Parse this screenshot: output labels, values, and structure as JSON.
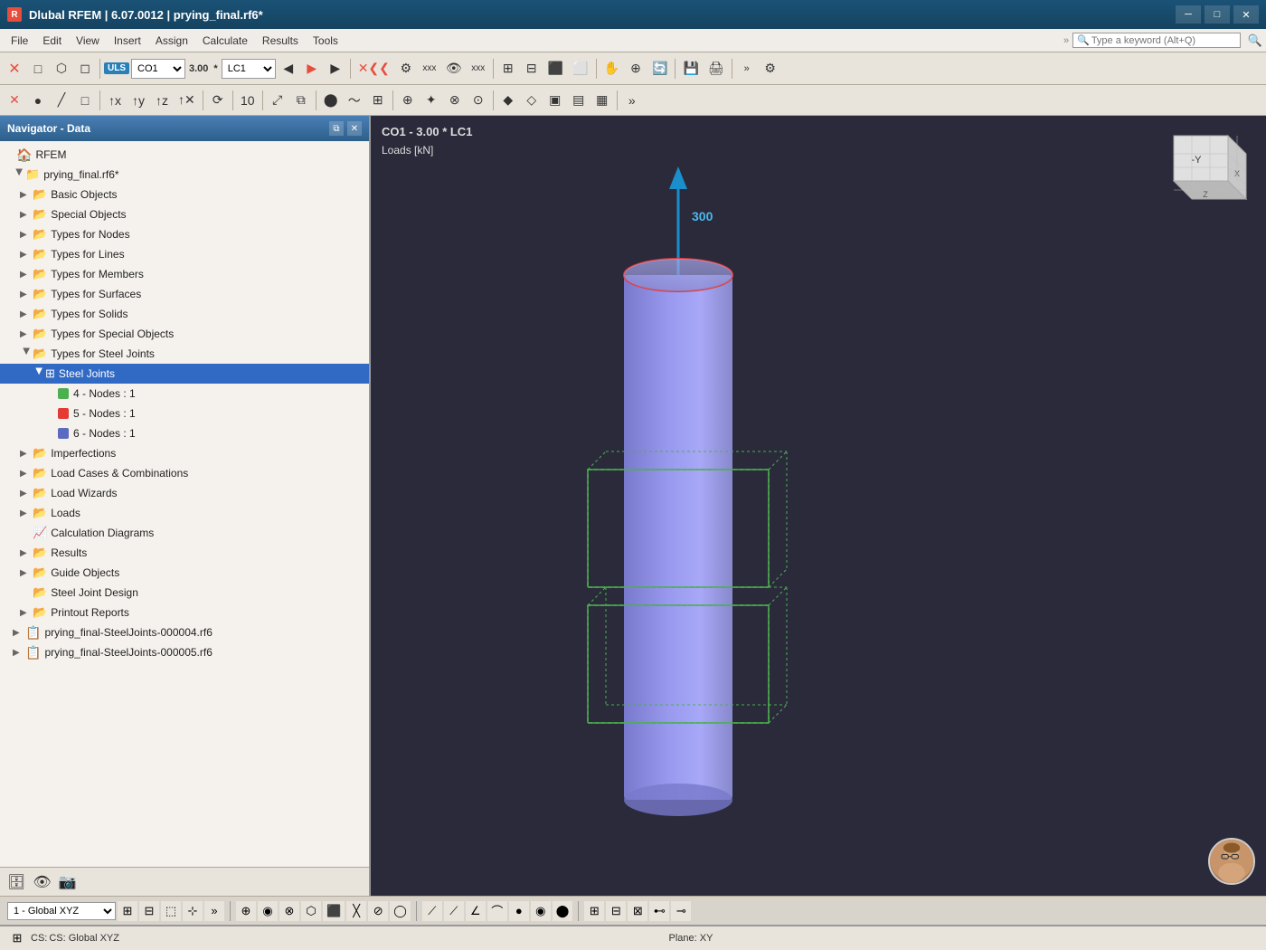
{
  "titleBar": {
    "icon": "R",
    "title": "Dlubal RFEM | 6.07.0012 | prying_final.rf6*",
    "controls": [
      "─",
      "□",
      "✕"
    ]
  },
  "menuBar": {
    "items": [
      "File",
      "Edit",
      "View",
      "Insert",
      "Assign",
      "Calculate",
      "Results",
      "Tools"
    ],
    "searchPlaceholder": "Type a keyword (Alt+Q)"
  },
  "toolbar": {
    "ulsLabel": "ULS",
    "co": "CO1",
    "multiplier": "3.00",
    "lc": "LC1"
  },
  "viewport": {
    "subtitle": "CO1 - 3.00 * LC1",
    "unit": "Loads [kN]",
    "loadValue": "300"
  },
  "navigator": {
    "title": "Navigator - Data",
    "rfem": "RFEM",
    "project": "prying_final.rf6*",
    "items": [
      {
        "id": "basic-objects",
        "label": "Basic Objects",
        "level": 1,
        "type": "folder",
        "arrow": true,
        "open": false
      },
      {
        "id": "special-objects",
        "label": "Special Objects",
        "level": 1,
        "type": "folder",
        "arrow": true,
        "open": false
      },
      {
        "id": "types-nodes",
        "label": "Types for Nodes",
        "level": 1,
        "type": "folder",
        "arrow": true,
        "open": false
      },
      {
        "id": "types-lines",
        "label": "Types for Lines",
        "level": 1,
        "type": "folder",
        "arrow": true,
        "open": false
      },
      {
        "id": "types-members",
        "label": "Types for Members",
        "level": 1,
        "type": "folder",
        "arrow": true,
        "open": false
      },
      {
        "id": "types-surfaces",
        "label": "Types for Surfaces",
        "level": 1,
        "type": "folder",
        "arrow": true,
        "open": false
      },
      {
        "id": "types-solids",
        "label": "Types for Solids",
        "level": 1,
        "type": "folder",
        "arrow": true,
        "open": false
      },
      {
        "id": "types-special",
        "label": "Types for Special Objects",
        "level": 1,
        "type": "folder",
        "arrow": true,
        "open": false
      },
      {
        "id": "types-steel",
        "label": "Types for Steel Joints",
        "level": 1,
        "type": "folder",
        "arrow": true,
        "open": true,
        "selected": false
      },
      {
        "id": "steel-joints",
        "label": "Steel Joints",
        "level": 2,
        "type": "folder-special",
        "arrow": true,
        "open": true,
        "selected": true
      },
      {
        "id": "node-4",
        "label": "4 - Nodes : 1",
        "level": 3,
        "type": "node",
        "color": "#4caf50"
      },
      {
        "id": "node-5",
        "label": "5 - Nodes : 1",
        "level": 3,
        "type": "node",
        "color": "#e53935"
      },
      {
        "id": "node-6",
        "label": "6 - Nodes : 1",
        "level": 3,
        "type": "node",
        "color": "#5c6bc0"
      },
      {
        "id": "imperfections",
        "label": "Imperfections",
        "level": 1,
        "type": "folder",
        "arrow": true,
        "open": false
      },
      {
        "id": "load-cases",
        "label": "Load Cases & Combinations",
        "level": 1,
        "type": "folder",
        "arrow": true,
        "open": false
      },
      {
        "id": "load-wizards",
        "label": "Load Wizards",
        "level": 1,
        "type": "folder",
        "arrow": true,
        "open": false
      },
      {
        "id": "loads",
        "label": "Loads",
        "level": 1,
        "type": "folder",
        "arrow": true,
        "open": false
      },
      {
        "id": "calc-diagrams",
        "label": "Calculation Diagrams",
        "level": 1,
        "type": "chart",
        "arrow": false
      },
      {
        "id": "results",
        "label": "Results",
        "level": 1,
        "type": "folder",
        "arrow": true,
        "open": false
      },
      {
        "id": "guide-objects",
        "label": "Guide Objects",
        "level": 1,
        "type": "folder",
        "arrow": true,
        "open": false
      },
      {
        "id": "steel-joint-design",
        "label": "Steel Joint Design",
        "level": 1,
        "type": "folder",
        "arrow": false
      },
      {
        "id": "printout-reports",
        "label": "Printout Reports",
        "level": 1,
        "type": "folder",
        "arrow": true,
        "open": false
      }
    ],
    "subProjects": [
      "prying_final-SteelJoints-000004.rf6",
      "prying_final-SteelJoints-000005.rf6"
    ]
  },
  "statusBar": {
    "coordinate": "1 - Global XYZ",
    "cs": "CS: Global XYZ",
    "plane": "Plane: XY"
  }
}
